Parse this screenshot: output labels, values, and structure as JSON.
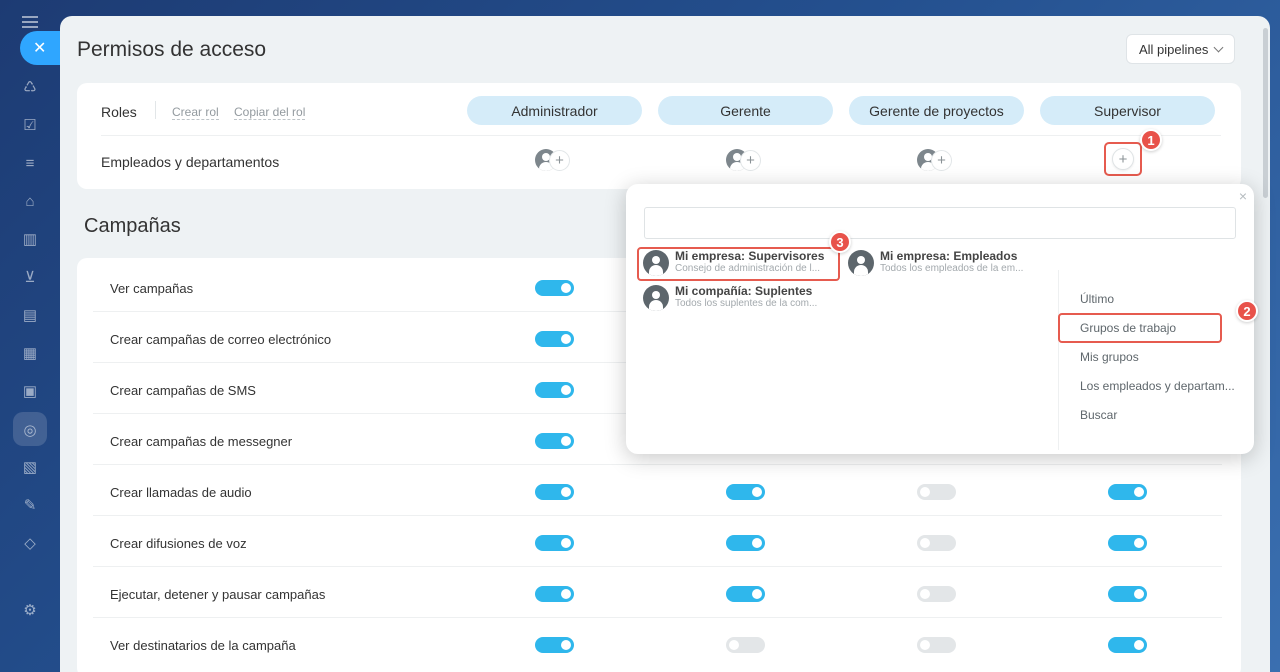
{
  "panel": {
    "title": "Permisos de acceso",
    "pipelines_label": "All pipelines"
  },
  "roles": {
    "label": "Roles",
    "create_link": "Crear rol",
    "copy_link": "Copiar del rol",
    "items": [
      "Administrador",
      "Gerente",
      "Gerente de proyectos",
      "Supervisor"
    ],
    "employees_label": "Empleados y departamentos"
  },
  "campaigns": {
    "title": "Campañas",
    "rows": [
      {
        "label": "Ver campañas",
        "toggles": [
          true,
          null,
          null,
          null
        ]
      },
      {
        "label": "Crear campañas de correo electrónico",
        "toggles": [
          true,
          null,
          null,
          null
        ]
      },
      {
        "label": "Crear campañas de SMS",
        "toggles": [
          true,
          null,
          null,
          null
        ]
      },
      {
        "label": "Crear campañas de messegner",
        "toggles": [
          true,
          null,
          null,
          null
        ]
      },
      {
        "label": "Crear llamadas de audio",
        "toggles": [
          true,
          true,
          false,
          true
        ]
      },
      {
        "label": "Crear difusiones de voz",
        "toggles": [
          true,
          true,
          false,
          true
        ]
      },
      {
        "label": "Ejecutar, detener y pausar campañas",
        "toggles": [
          true,
          true,
          false,
          true
        ]
      },
      {
        "label": "Ver destinatarios de la campaña",
        "toggles": [
          true,
          false,
          false,
          true
        ]
      }
    ]
  },
  "popup": {
    "close": "×",
    "entities": [
      {
        "title": "Mi empresa: Supervisores",
        "subtitle": "Consejo de administración de l..."
      },
      {
        "title": "Mi empresa: Empleados",
        "subtitle": "Todos los empleados de la em..."
      },
      {
        "title": "Mi compañía: Suplentes",
        "subtitle": "Todos los suplentes de la com..."
      }
    ],
    "tabs": [
      "Último",
      "Grupos de trabajo",
      "Mis grupos",
      "Los empleados y departam...",
      "Buscar"
    ]
  },
  "annotations": [
    "1",
    "2",
    "3"
  ],
  "colors": {
    "accent": "#2fb7ec",
    "highlight": "#e65b4f",
    "pill": "#d5ecf9"
  }
}
